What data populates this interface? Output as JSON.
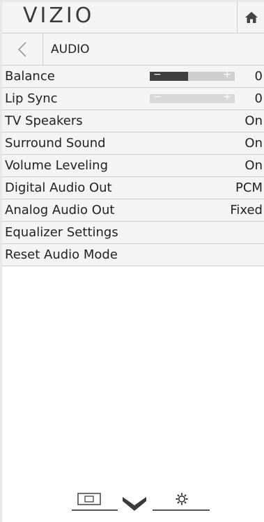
{
  "header": {
    "logo": "VIZIO",
    "home_icon": "home-icon"
  },
  "breadcrumb": {
    "back_icon": "back-arrow-icon",
    "title": "AUDIO"
  },
  "menu": {
    "items": [
      {
        "label": "Balance",
        "value": "0",
        "slider": {
          "minus": "−",
          "plus": "+",
          "level": 0.45
        }
      },
      {
        "label": "Lip Sync",
        "value": "0",
        "slider": {
          "minus": "−",
          "plus": "+",
          "level": 0.0
        }
      },
      {
        "label": "TV Speakers",
        "value": "On"
      },
      {
        "label": "Surround Sound",
        "value": "On"
      },
      {
        "label": "Volume Leveling",
        "value": "On"
      },
      {
        "label": "Digital Audio Out",
        "value": "PCM"
      },
      {
        "label": "Analog Audio Out",
        "value": "Fixed"
      },
      {
        "label": "Equalizer Settings",
        "value": ""
      },
      {
        "label": "Reset Audio Mode",
        "value": ""
      }
    ]
  },
  "footer": {
    "icons": [
      "picture-icon",
      "chevron-down-icon",
      "gear-icon"
    ]
  },
  "colors": {
    "panel_bg": "#f4f4f4",
    "divider": "#cfcfcf",
    "slider_fill": "#3e3e3e",
    "slider_track": "#cfcfcf"
  }
}
